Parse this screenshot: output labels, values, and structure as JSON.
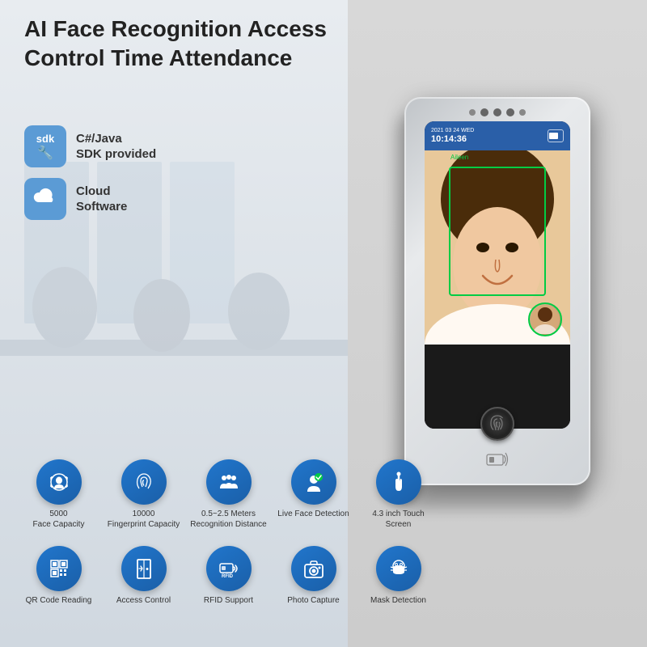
{
  "page": {
    "title_line1": "AI Face Recognition Access",
    "title_line2": "Control Time Attendance"
  },
  "sdk_badge": {
    "label": "sdk",
    "text_line1": "C#/Java",
    "text_line2": "SDK provided"
  },
  "cloud_badge": {
    "text_line1": "Cloud",
    "text_line2": "Software"
  },
  "device": {
    "date": "2021 03 24",
    "day": "WED",
    "time": "10:14:36",
    "user_name": "Aileen"
  },
  "features_row1": [
    {
      "id": "face-capacity",
      "label": "5000\nFace Capacity",
      "icon": "face"
    },
    {
      "id": "fingerprint-capacity",
      "label": "10000\nFingerprint Capacity",
      "icon": "fingerprint"
    },
    {
      "id": "recognition-distance",
      "label": "0.5~2.5 Meters\nRecognition Distance",
      "icon": "people"
    },
    {
      "id": "live-face",
      "label": "Live Face Detection",
      "icon": "person-check"
    },
    {
      "id": "touch-screen",
      "label": "4.3 inch Touch Screen",
      "icon": "touch"
    }
  ],
  "features_row2": [
    {
      "id": "qr-reading",
      "label": "QR Code Reading",
      "icon": "qr"
    },
    {
      "id": "access-control",
      "label": "Access Control",
      "icon": "door"
    },
    {
      "id": "rfid-support",
      "label": "RFID Support",
      "icon": "rfid"
    },
    {
      "id": "photo-capture",
      "label": "Photo Capture",
      "icon": "camera"
    },
    {
      "id": "mask-detection",
      "label": "Mask Detection",
      "icon": "mask"
    }
  ],
  "colors": {
    "accent_blue": "#1a6cb5",
    "title_dark": "#222222",
    "feature_label": "#444444"
  }
}
